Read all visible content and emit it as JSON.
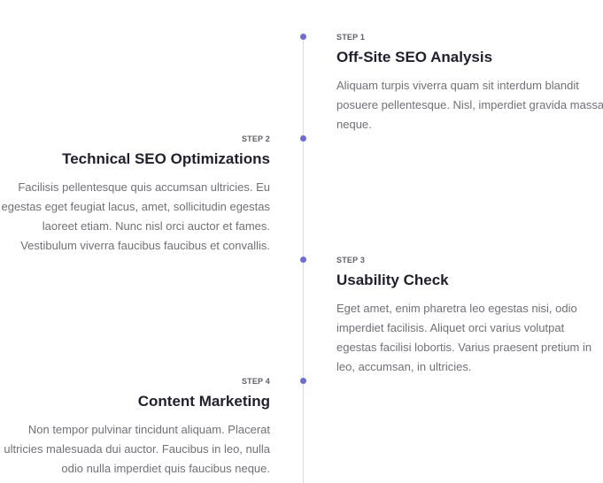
{
  "colors": {
    "accent": "#6b6be0",
    "axis": "#d9dbe3",
    "title": "#1f1f2e",
    "body": "#707078"
  },
  "steps": [
    {
      "label": "STEP 1",
      "title": "Off-Site SEO Analysis",
      "description": "Aliquam turpis viverra quam sit interdum blandit posuere pellentesque. Nisl, imperdiet gravida massa neque."
    },
    {
      "label": "STEP 2",
      "title": "Technical SEO Optimizations",
      "description": "Facilisis pellentesque quis accumsan ultricies. Eu egestas eget feugiat lacus, amet, sollicitudin egestas laoreet etiam. Nunc nisl orci auctor et fames. Vestibulum viverra faucibus faucibus et convallis."
    },
    {
      "label": "STEP 3",
      "title": "Usability Check",
      "description": "Eget amet, enim pharetra leo egestas nisi, odio imperdiet facilisis. Aliquet orci varius volutpat egestas facilisi lobortis. Varius praesent pretium in leo, accumsan, in ultricies."
    },
    {
      "label": "STEP 4",
      "title": "Content Marketing",
      "description": "Non tempor pulvinar tincidunt aliquam. Placerat ultricies malesuada dui auctor. Faucibus in leo, nulla odio nulla imperdiet quis faucibus neque."
    }
  ]
}
